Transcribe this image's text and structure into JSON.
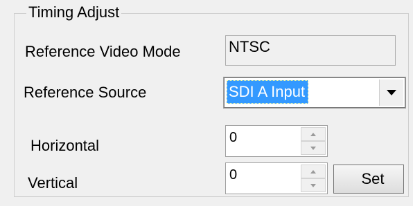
{
  "group": {
    "title": "Timing Adjust"
  },
  "reference_video_mode": {
    "label": "Reference Video Mode",
    "value": "NTSC"
  },
  "reference_source": {
    "label": "Reference Source",
    "selected": "SDI A Input"
  },
  "horizontal": {
    "label": "Horizontal",
    "value": "0"
  },
  "vertical": {
    "label": "Vertical",
    "value": "0"
  },
  "set_button": {
    "label": "Set"
  },
  "icons": {
    "dropdown": "chevron-down-icon",
    "spin_up": "spin-up-icon",
    "spin_down": "spin-down-icon"
  },
  "colors": {
    "selection": "#3399ff",
    "background": "#f0f0f0"
  }
}
